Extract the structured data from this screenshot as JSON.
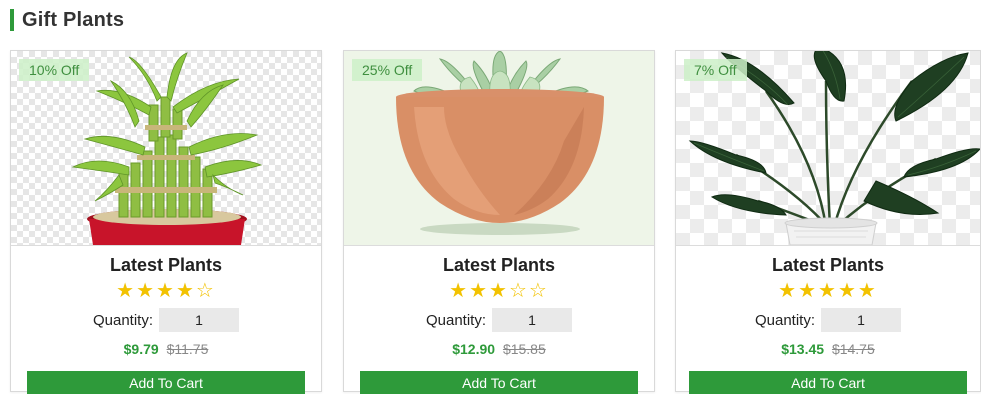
{
  "section": {
    "title": "Gift Plants"
  },
  "colors": {
    "accent": "#2e9a3a",
    "star": "#f2c200",
    "badge_bg": "#cdf0c8"
  },
  "products": [
    {
      "discount": "10% Off",
      "title": "Latest Plants",
      "rating": 4,
      "stars_display": "★★★★☆",
      "quantity_label": "Quantity:",
      "quantity": "1",
      "price": "$9.79",
      "old_price": "$11.75",
      "button": "Add To Cart",
      "image_icon": "lucky-bamboo-icon"
    },
    {
      "discount": "25% Off",
      "title": "Latest Plants",
      "rating": 3,
      "stars_display": "★★★☆☆",
      "quantity_label": "Quantity:",
      "quantity": "1",
      "price": "$12.90",
      "old_price": "$15.85",
      "button": "Add To Cart",
      "image_icon": "succulent-pot-icon"
    },
    {
      "discount": "7% Off",
      "title": "Latest Plants",
      "rating": 5,
      "stars_display": "★★★★★",
      "quantity_label": "Quantity:",
      "quantity": "1",
      "price": "$13.45",
      "old_price": "$14.75",
      "button": "Add To Cart",
      "image_icon": "bird-of-paradise-icon"
    }
  ]
}
